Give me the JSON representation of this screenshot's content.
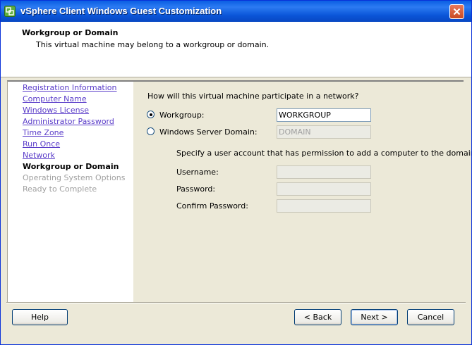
{
  "window": {
    "title": "vSphere Client Windows Guest Customization"
  },
  "header": {
    "title": "Workgroup or Domain",
    "subtitle": "This virtual machine may belong to a workgroup or domain."
  },
  "nav": {
    "items": [
      {
        "label": "Registration Information",
        "state": "link"
      },
      {
        "label": "Computer Name",
        "state": "link"
      },
      {
        "label": "Windows License",
        "state": "link"
      },
      {
        "label": "Administrator Password",
        "state": "link"
      },
      {
        "label": "Time Zone",
        "state": "link"
      },
      {
        "label": "Run Once",
        "state": "link"
      },
      {
        "label": "Network",
        "state": "link"
      },
      {
        "label": "Workgroup or Domain",
        "state": "current"
      },
      {
        "label": "Operating System Options",
        "state": "disabled"
      },
      {
        "label": "Ready to Complete",
        "state": "disabled"
      }
    ]
  },
  "form": {
    "question": "How will this virtual machine participate in a network?",
    "workgroup": {
      "label": "Workgroup:",
      "value": "WORKGROUP",
      "selected": true
    },
    "domain": {
      "label": "Windows Server Domain:",
      "value": "DOMAIN",
      "selected": false
    },
    "account_hint": "Specify a user account that has permission to add a computer to the domain.",
    "username": {
      "label": "Username:",
      "value": ""
    },
    "password": {
      "label": "Password:",
      "value": ""
    },
    "confirm_password": {
      "label": "Confirm Password:",
      "value": ""
    }
  },
  "buttons": {
    "help": "Help",
    "back": "< Back",
    "next": "Next >",
    "cancel": "Cancel"
  },
  "colors": {
    "titlebar": "#0a5ee3",
    "link": "#5a3cc9",
    "disabled_text": "#a0a0a0",
    "dialog_bg": "#ece9d8"
  }
}
